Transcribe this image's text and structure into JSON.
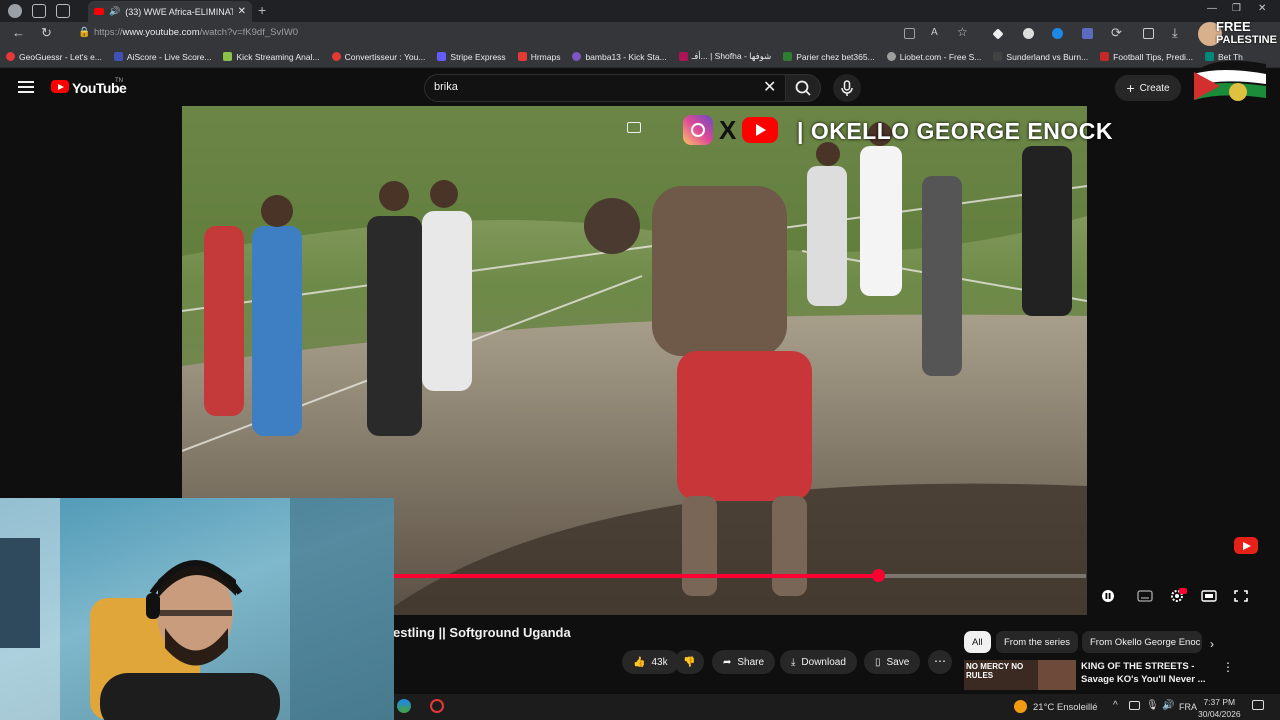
{
  "browser": {
    "tab_title": "(33) WWE Africa-ELIMINATI",
    "url_prefix": "https://",
    "url_host": "www.youtube.com",
    "url_path": "/watch?v=fK9df_SvIW0",
    "bookmarks": [
      {
        "label": "GeoGuessr - Let's e...",
        "color": "#e53935"
      },
      {
        "label": "AiScore - Live Score...",
        "color": "#3f51b5"
      },
      {
        "label": "Kick Streaming Anal...",
        "color": "#8bc34a"
      },
      {
        "label": "Convertisseur : You...",
        "color": "#e53935"
      },
      {
        "label": "Stripe Express",
        "color": "#635bff"
      },
      {
        "label": "Hrmaps",
        "color": "#e53935"
      },
      {
        "label": "bamba13 - Kick Sta...",
        "color": "#7e57c2"
      },
      {
        "label": "أفـ... | Shofha - شوفها",
        "color": "#ad1457"
      },
      {
        "label": "Parier chez bet365...",
        "color": "#2e7d32"
      },
      {
        "label": "Liobet.com - Free S...",
        "color": "#9e9e9e"
      },
      {
        "label": "Sunderland vs Burn...",
        "color": "#424242"
      },
      {
        "label": "Football Tips, Predi...",
        "color": "#c62828"
      },
      {
        "label": "Bet Th",
        "color": "#00897b"
      }
    ]
  },
  "youtube": {
    "logo_text": "YouTube",
    "logo_country": "TN",
    "search_value": "brika",
    "create_label": "Create"
  },
  "video": {
    "overlay_text": "| OKELLO GEORGE ENOCK",
    "progress_fraction": 0.7,
    "title": "estling || Softground Uganda",
    "likes": "43k",
    "share_label": "Share",
    "download_label": "Download",
    "save_label": "Save"
  },
  "sidebar_chips": [
    {
      "label": "All",
      "active": true
    },
    {
      "label": "From the series",
      "active": false
    },
    {
      "label": "From Okello George Enoc",
      "active": false
    }
  ],
  "recommendation": {
    "title": "KING OF THE STREETS - Savage KO's You'll Never ...",
    "thumb_text": "NO MERCY NO RULES"
  },
  "badge": {
    "text_line1": "FREE",
    "text_line2": "PALESTINE"
  },
  "taskbar": {
    "weather": "21°C  Ensoleillé",
    "lang": "FRA",
    "time": "7:37 PM",
    "date": "30/04/2026"
  },
  "colors": {
    "accent": "#ff0033",
    "bg": "#0f0f0f"
  }
}
